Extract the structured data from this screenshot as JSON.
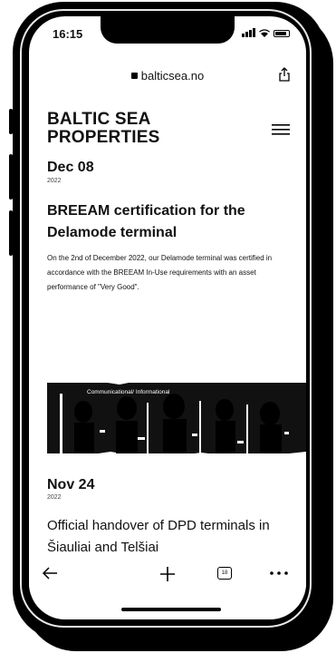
{
  "status": {
    "time": "16:15"
  },
  "browser": {
    "url": "balticsea.no",
    "tab_count": "18"
  },
  "site": {
    "brand_line1": "BALTIC SEA",
    "brand_line2": "PROPERTIES"
  },
  "posts": [
    {
      "date": "Dec 08",
      "year": "2022",
      "title": "BREEAM certification for the Delamode terminal",
      "excerpt": "On the 2nd of December 2022, our Delamode terminal was certified in accordance with the BREEAM In-Use requirements with an asset performance of \"Very Good\".",
      "image_caption": "Communicational/ Informational"
    },
    {
      "date": "Nov 24",
      "year": "2022",
      "title": "Official handover of DPD terminals in Šiauliai and Telšiai"
    }
  ]
}
